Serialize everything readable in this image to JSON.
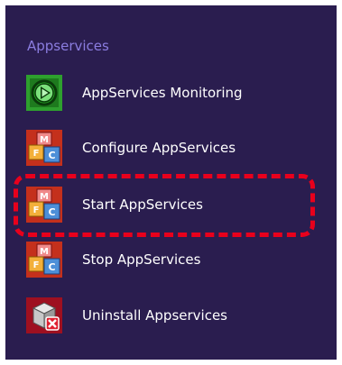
{
  "group": {
    "title": "Appservices"
  },
  "tiles": [
    {
      "label": "AppServices Monitoring",
      "icon": "monitoring-play-icon",
      "tile_color": "#2ea02e"
    },
    {
      "label": "Configure AppServices",
      "icon": "mfc-blocks-icon",
      "tile_color": "#c4301c"
    },
    {
      "label": "Start AppServices",
      "icon": "mfc-blocks-icon",
      "tile_color": "#c4301c"
    },
    {
      "label": "Stop AppServices",
      "icon": "mfc-blocks-icon",
      "tile_color": "#c4301c"
    },
    {
      "label": "Uninstall Appservices",
      "icon": "uninstall-box-icon",
      "tile_color": "#9e1020"
    }
  ],
  "highlight_color": "#e8001c"
}
